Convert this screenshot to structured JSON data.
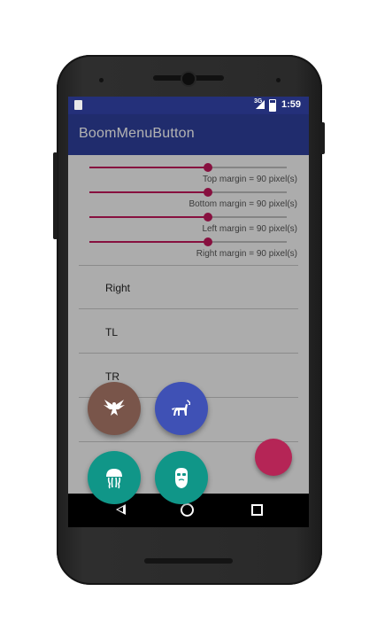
{
  "status_bar": {
    "time": "1:59",
    "network": "3G"
  },
  "app_bar": {
    "title": "BoomMenuButton"
  },
  "sliders": [
    {
      "label": "Top margin = 90 pixel(s)",
      "value_fraction": 0.6
    },
    {
      "label": "Bottom margin = 90 pixel(s)",
      "value_fraction": 0.6
    },
    {
      "label": "Left margin = 90 pixel(s)",
      "value_fraction": 0.6
    },
    {
      "label": "Right margin = 90 pixel(s)",
      "value_fraction": 0.6
    }
  ],
  "list": [
    {
      "label": "Right"
    },
    {
      "label": "TL"
    },
    {
      "label": "TR"
    }
  ],
  "boom_buttons": [
    {
      "icon": "eagle-icon",
      "color": "#79554a"
    },
    {
      "icon": "horse-icon",
      "color": "#3f51b5"
    },
    {
      "icon": "jellyfish-icon",
      "color": "#109688"
    },
    {
      "icon": "bearded-face-icon",
      "color": "#109688"
    }
  ],
  "fab": {
    "color": "#b52556"
  },
  "colors": {
    "primary": "#2f3f9c",
    "primary_dark": "#24307a",
    "accent": "#c2185b"
  }
}
